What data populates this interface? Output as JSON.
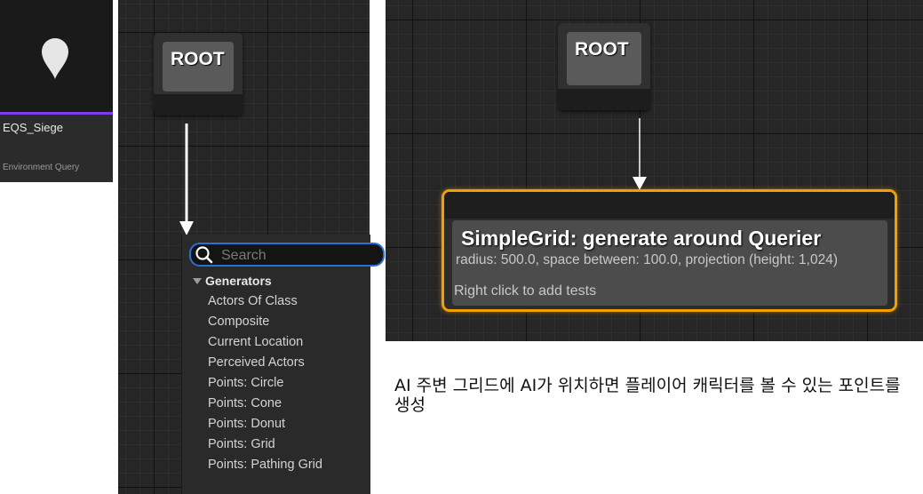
{
  "asset": {
    "name": "EQS_Siege",
    "type": "Environment Query",
    "icon": "map-pin-icon",
    "accent_color": "#7b3fe0"
  },
  "graph_left": {
    "root_label": "ROOT"
  },
  "menu": {
    "search_placeholder": "Search",
    "category": "Generators",
    "items": [
      "Actors Of Class",
      "Composite",
      "Current Location",
      "Perceived Actors",
      "Points: Circle",
      "Points: Cone",
      "Points: Donut",
      "Points: Grid",
      "Points: Pathing Grid"
    ]
  },
  "graph_right": {
    "root_label": "ROOT",
    "generator": {
      "title": "SimpleGrid: generate around Querier",
      "description": "radius: 500.0, space between: 100.0, projection (height: 1,024)",
      "hint": "Right click to add tests",
      "highlight_color": "#f0a000"
    }
  },
  "caption": "AI 주변 그리드에 AI가 위치하면 플레이어 캐릭터를 볼 수 있는 포인트를 생성"
}
